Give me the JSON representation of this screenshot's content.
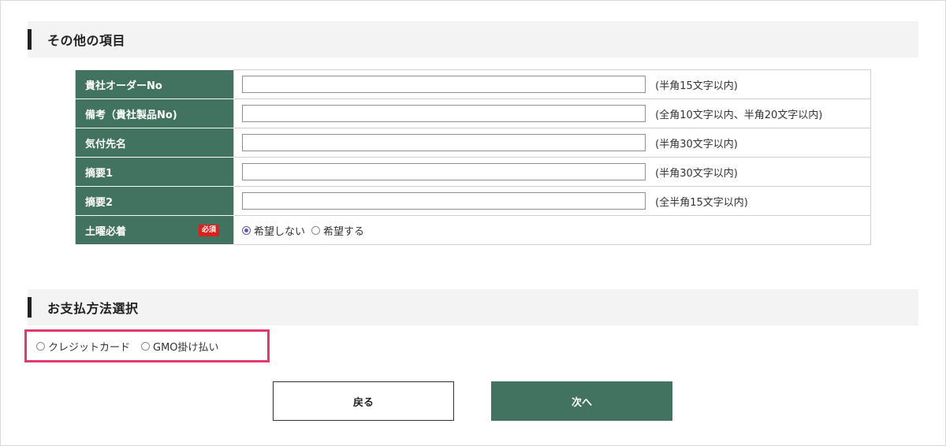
{
  "sections": {
    "other": {
      "title": "その他の項目"
    },
    "payment": {
      "title": "お支払方法選択"
    }
  },
  "form": {
    "rows": [
      {
        "label": "貴社オーダーNo",
        "value": "",
        "hint": "(半角15文字以内)"
      },
      {
        "label": "備考（貴社製品No)",
        "value": "",
        "hint": "(全角10文字以内、半角20文字以内)"
      },
      {
        "label": "気付先名",
        "value": "",
        "hint": "(半角30文字以内)"
      },
      {
        "label": "摘要1",
        "value": "",
        "hint": "(半角30文字以内)"
      },
      {
        "label": "摘要2",
        "value": "",
        "hint": "(全半角15文字以内)"
      }
    ],
    "saturday": {
      "label": "土曜必着",
      "required_badge": "必須",
      "options": [
        {
          "label": "希望しない",
          "selected": true
        },
        {
          "label": "希望する",
          "selected": false
        }
      ]
    }
  },
  "payment": {
    "options": [
      {
        "label": "クレジットカード",
        "selected": false
      },
      {
        "label": "GMO掛け払い",
        "selected": false
      }
    ],
    "highlight_color": "#e23a6b"
  },
  "buttons": {
    "back_label": "戻る",
    "next_label": "次へ"
  },
  "colors": {
    "label_bg": "#427260",
    "accent": "#427260",
    "required": "#d9211d"
  }
}
